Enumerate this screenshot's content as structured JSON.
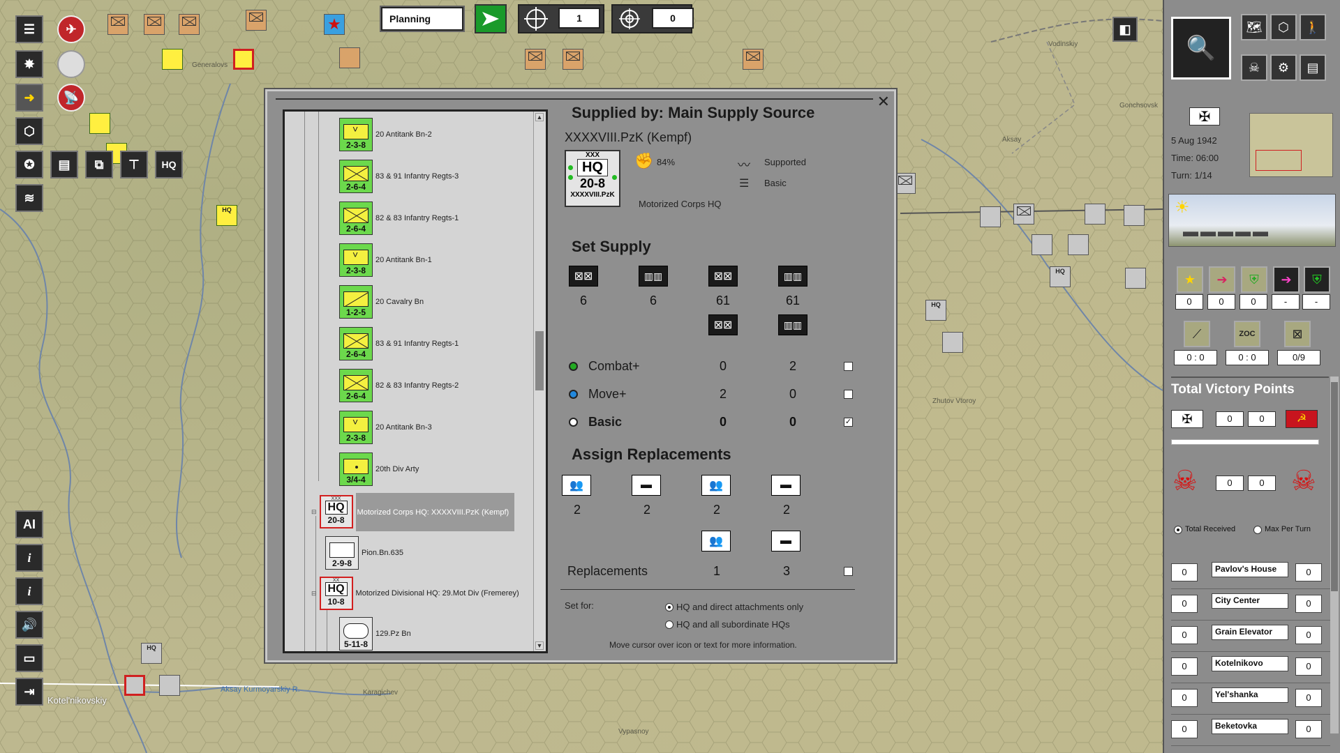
{
  "toolbar": {
    "phase": "Planning",
    "count_a": "1",
    "count_b": "0"
  },
  "map": {
    "towns": [
      "Generalovs",
      "Vodinskiy",
      "Aksay",
      "Gonchsovsk",
      "Zhutov Vtoroy",
      "Kotel'nikovskiy",
      "Aksay Kurmoyarskiy R.",
      "Karagichev",
      "Vypasnoy"
    ],
    "left_buttons": {
      "ai": "AI",
      "hq": "HQ",
      "info1": "i",
      "info2": "i"
    }
  },
  "dialog": {
    "supplied_by": "Supplied by: Main Supply Source",
    "unit_name": "XXXXVIII.PzK (Kempf)",
    "unit_counter": {
      "echelon": "XXX",
      "label": "HQ",
      "stats": "20-8",
      "footer": "XXXXVIII.PzK"
    },
    "supply_pct": "84%",
    "supported": "Supported",
    "basic_status": "Basic",
    "unit_type": "Motorized Corps HQ",
    "set_supply_title": "Set Supply",
    "supply_counts": [
      "6",
      "6",
      "61",
      "61"
    ],
    "supply_rows": [
      {
        "label": "Combat+",
        "dot": "#22aa22",
        "a": "0",
        "b": "2",
        "checked": ""
      },
      {
        "label": "Move+",
        "dot": "#2288dd",
        "a": "2",
        "b": "0",
        "checked": ""
      },
      {
        "label": "Basic",
        "dot": "#ffffff",
        "a": "0",
        "b": "0",
        "checked": "✓"
      }
    ],
    "assign_title": "Assign Replacements",
    "repl_counts": [
      "2",
      "2",
      "2",
      "2"
    ],
    "repl_label": "Replacements",
    "repl_values": [
      "1",
      "3"
    ],
    "set_for": "Set for:",
    "option_1": "HQ and direct attachments only",
    "option_2": "HQ and all subordinate HQs",
    "hint": "Move cursor over icon or text for more information."
  },
  "tree": {
    "rows": [
      {
        "label": "20 Antitank Bn-2",
        "stats": "2-3-8",
        "sym": "vee"
      },
      {
        "label": "83 & 91  Infantry Regts-3",
        "stats": "2-6-4",
        "sym": "cross"
      },
      {
        "label": "82 & 83 Infantry Regts-1",
        "stats": "2-6-4",
        "sym": "cross"
      },
      {
        "label": "20 Antitank Bn-1",
        "stats": "2-3-8",
        "sym": "vee"
      },
      {
        "label": "20 Cavalry Bn",
        "stats": "1-2-5",
        "sym": "diag"
      },
      {
        "label": "83 & 91  Infantry Regts-1",
        "stats": "2-6-4",
        "sym": "cross"
      },
      {
        "label": "82 & 83 Infantry Regts-2",
        "stats": "2-6-4",
        "sym": "cross"
      },
      {
        "label": "20 Antitank Bn-3",
        "stats": "2-3-8",
        "sym": "vee"
      },
      {
        "label": "20th Div Arty",
        "stats": "3/4-4",
        "sym": "dot"
      }
    ],
    "corps_hq": {
      "label": "Motorized Corps HQ: XXXXVIII.PzK (Kempf)",
      "text": "HQ",
      "stats": "20-8",
      "echelon": "XXX"
    },
    "pion": {
      "label": "Pion.Bn.635",
      "stats": "2-9-8"
    },
    "div_hq": {
      "label": "Motorized Divisional HQ: 29.Mot Div (Fremerey)",
      "text": "HQ",
      "stats": "10-8",
      "echelon": "XX"
    },
    "pz": {
      "label": "129.Pz Bn",
      "stats": "5-11-8"
    }
  },
  "right_panel": {
    "date": "5 Aug 1942",
    "time": "Time: 06:00",
    "turn": "Turn: 1/14",
    "counts_row1": [
      "0",
      "0",
      "0",
      "-",
      "-"
    ],
    "counts_row2": [
      "0 : 0",
      "0 : 0",
      "0/9"
    ],
    "zoc_label": "ZOC",
    "vp_title": "Total Victory Points",
    "vp_flags": [
      "0",
      "0"
    ],
    "vp_losses": [
      "0",
      "0"
    ],
    "total_received": "Total Received",
    "max_per_turn": "Max Per Turn",
    "objectives": [
      {
        "left": "0",
        "name": "Pavlov's House",
        "right": "0"
      },
      {
        "left": "0",
        "name": "City Center",
        "right": "0"
      },
      {
        "left": "0",
        "name": "Grain Elevator",
        "right": "0"
      },
      {
        "left": "0",
        "name": "Kotelnikovo",
        "right": "0"
      },
      {
        "left": "0",
        "name": "Yel'shanka",
        "right": "0"
      },
      {
        "left": "0",
        "name": "Beketovka",
        "right": "0"
      }
    ]
  }
}
